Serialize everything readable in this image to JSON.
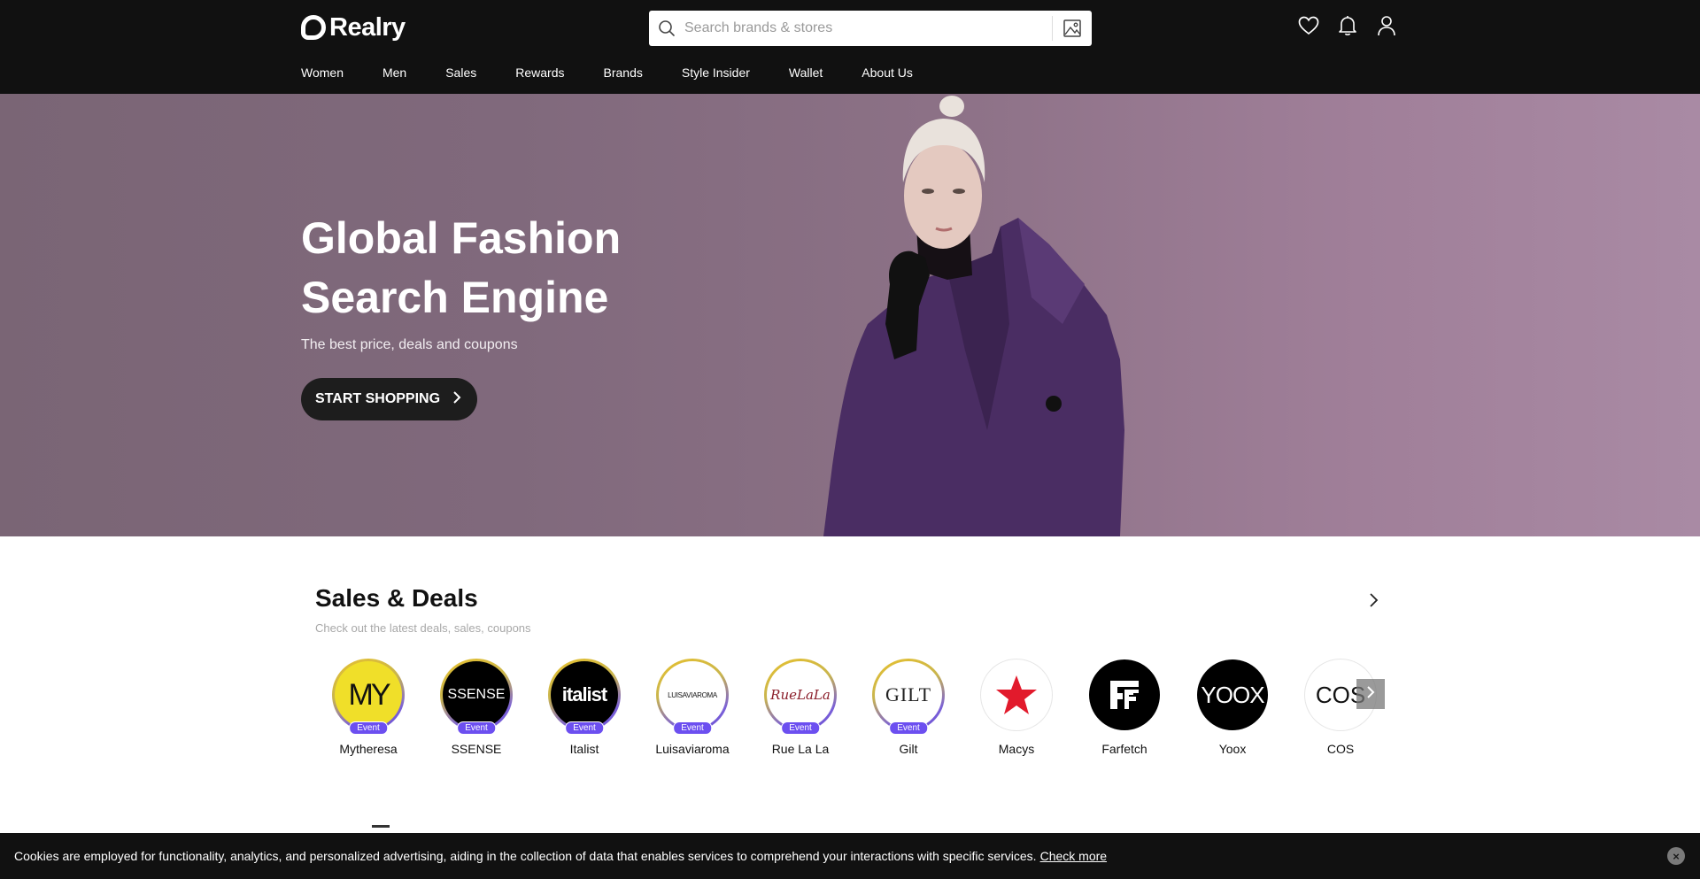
{
  "header": {
    "brand": "Realry",
    "search": {
      "placeholder": "Search brands & stores",
      "value": ""
    },
    "icons": [
      "heart-icon",
      "bell-icon",
      "user-icon"
    ],
    "nav": [
      "Women",
      "Men",
      "Sales",
      "Rewards",
      "Brands",
      "Style Insider",
      "Wallet",
      "About Us"
    ]
  },
  "hero": {
    "title": "Global Fashion Search Engine",
    "subtitle": "The best price, deals and coupons",
    "cta": "START SHOPPING",
    "colors": {
      "background": "#8c7186",
      "coat": "#4a2d63"
    }
  },
  "deals": {
    "title": "Sales & Deals",
    "subtitle": "Check out the latest deals, sales, coupons",
    "stores": [
      {
        "name": "Mytheresa",
        "logo_text": "MY",
        "badge": "Event"
      },
      {
        "name": "SSENSE",
        "logo_text": "SSENSE",
        "badge": "Event"
      },
      {
        "name": "Italist",
        "logo_text": "italist",
        "badge": "Event"
      },
      {
        "name": "Luisaviaroma",
        "logo_text": "LUISAVIAROMA",
        "badge": "Event"
      },
      {
        "name": "Rue La La",
        "logo_text": "RueLaLa",
        "badge": "Event"
      },
      {
        "name": "Gilt",
        "logo_text": "GILT",
        "badge": "Event"
      },
      {
        "name": "Macys",
        "logo_text": "",
        "badge": ""
      },
      {
        "name": "Farfetch",
        "logo_text": "",
        "badge": ""
      },
      {
        "name": "Yoox",
        "logo_text": "YOOX",
        "badge": ""
      },
      {
        "name": "COS",
        "logo_text": "COS",
        "badge": ""
      }
    ]
  },
  "cookie": {
    "text": "Cookies are employed for functionality, analytics, and personalized advertising, aiding in the collection of data that enables services to comprehend your interactions with specific services.",
    "link": "Check more",
    "close": "×"
  },
  "colors": {
    "header_bg": "#111111",
    "badge": "#6c4ff0",
    "macys_star": "#e21a2c"
  }
}
